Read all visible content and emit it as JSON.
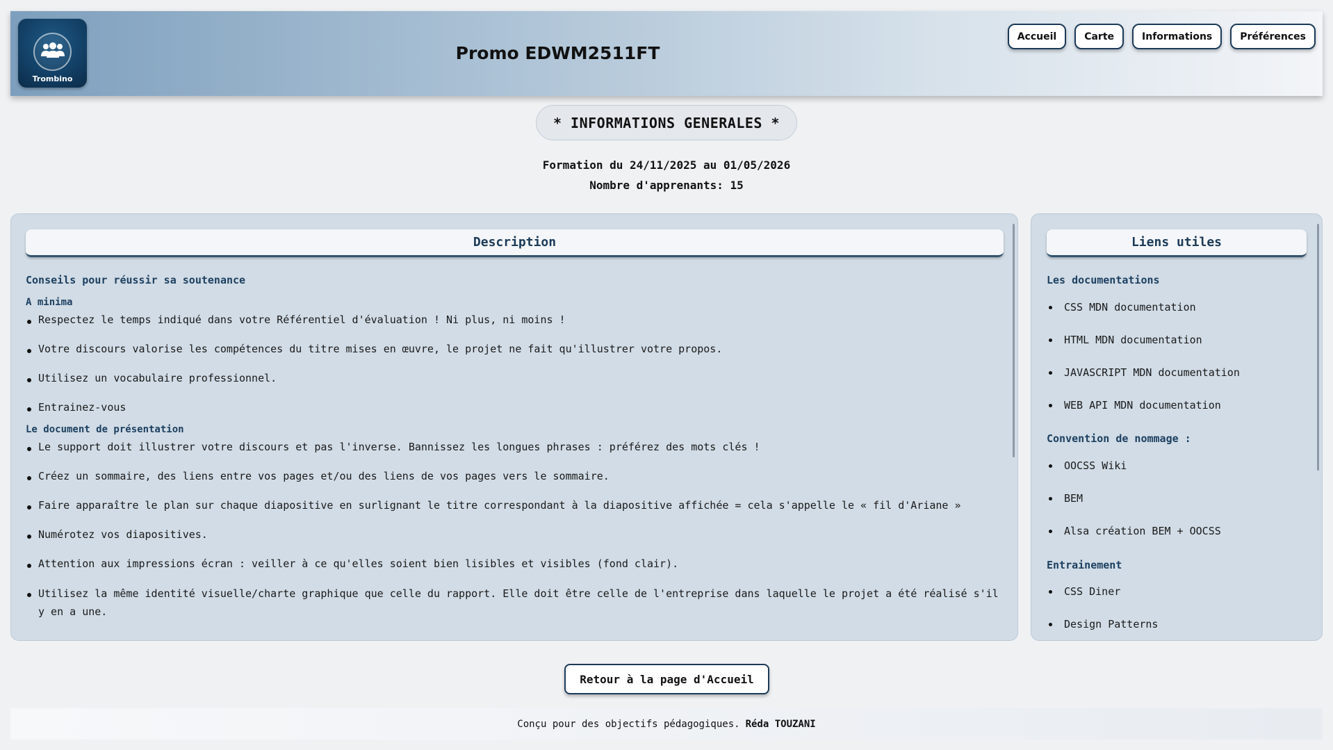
{
  "header": {
    "logo_text": "Trombino",
    "title": "Promo EDWM2511FT",
    "nav": [
      "Accueil",
      "Carte",
      "Informations",
      "Préférences"
    ]
  },
  "section_title": "* INFORMATIONS GENERALES *",
  "formation": "Formation du 24/11/2025 au 01/05/2026",
  "apprenants": "Nombre d'apprenants: 15",
  "description": {
    "header": "Description",
    "subtitle": "Conseils pour réussir sa soutenance",
    "group1_title": "A minima",
    "group1_items": [
      "Respectez le temps indiqué dans votre Référentiel d'évaluation ! Ni plus, ni moins !",
      "Votre discours valorise les compétences du titre mises en œuvre, le projet ne fait qu'illustrer votre propos.",
      "Utilisez un vocabulaire professionnel.",
      "Entrainez-vous"
    ],
    "group2_title": "Le document de présentation",
    "group2_items": [
      "Le support doit illustrer votre discours et pas l'inverse. Bannissez les longues phrases : préférez des mots clés !",
      "Créez un sommaire, des liens entre vos pages et/ou des liens de vos pages vers le sommaire.",
      "Faire apparaître le plan sur chaque diapositive en surlignant le titre correspondant à la diapositive affichée = cela s'appelle le « fil d'Ariane »",
      "Numérotez vos diapositives.",
      "Attention aux impressions écran : veiller à ce qu'elles soient bien lisibles et visibles (fond clair).",
      "Utilisez la même identité visuelle/charte graphique que celle du rapport. Elle doit être celle de l'entreprise dans laquelle le projet a été réalisé s'il y en a une."
    ]
  },
  "links": {
    "header": "Liens utiles",
    "doc_title": "Les documentations",
    "doc_items": [
      "CSS MDN documentation",
      "HTML MDN documentation",
      "JAVASCRIPT MDN documentation",
      "WEB API MDN documentation"
    ],
    "naming_title": "Convention de nommage :",
    "naming_items": [
      "OOCSS Wiki",
      "BEM",
      "Alsa création BEM + OOCSS"
    ],
    "training_title": "Entrainement",
    "training_items": [
      "CSS Diner",
      "Design Patterns"
    ]
  },
  "back_button": "Retour à la page d'Accueil",
  "footer": {
    "text": "Conçu pour des objectifs pédagogiques.",
    "author": "Réda TOUZANI"
  }
}
